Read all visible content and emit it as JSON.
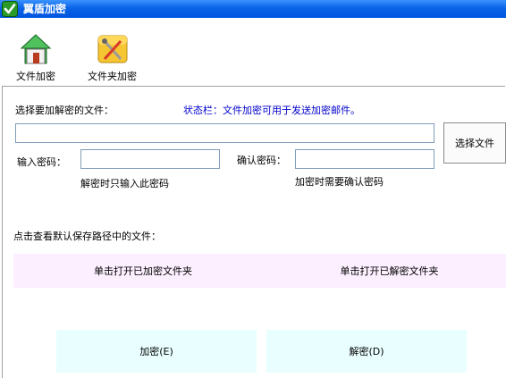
{
  "window": {
    "title": "翼盾加密"
  },
  "toolbar": {
    "items": [
      {
        "label": "文件加密",
        "icon": "house-icon"
      },
      {
        "label": "文件夹加密",
        "icon": "folder-tools-icon"
      }
    ]
  },
  "form": {
    "select_file_label": "选择要加解密的文件：",
    "status_text": "状态栏：文件加密可用于发送加密邮件。",
    "file_path_value": "",
    "browse_button": "选择文件",
    "password_label": "输入密码：",
    "password_value": "",
    "password_hint": "解密时只输入此密码",
    "confirm_label": "确认密码：",
    "confirm_value": "",
    "confirm_hint": "加密时需要确认密码"
  },
  "default_path": {
    "label": "点击查看默认保存路径中的文件：",
    "open_encrypted_button": "单击打开已加密文件夹",
    "open_decrypted_button": "单击打开已解密文件夹"
  },
  "actions": {
    "encrypt_button": "加密(E)",
    "decrypt_button": "解密(D)"
  },
  "colors": {
    "titlebar": "#0a64e6",
    "status_text": "#0000cc",
    "pink_bar": "#fcefff",
    "cyan_button": "#e9ffff"
  }
}
